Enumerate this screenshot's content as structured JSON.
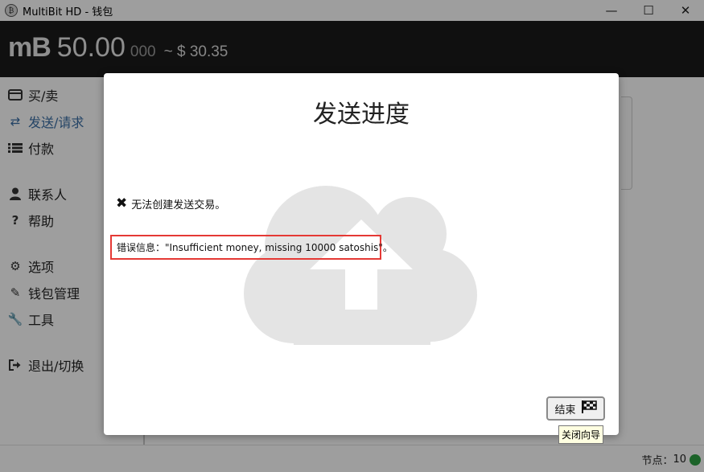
{
  "window": {
    "title": "MultiBit HD - 钱包",
    "minimize": "—",
    "maximize": "☐",
    "close": "✕"
  },
  "header": {
    "currency_symbol": "mB",
    "balance_main": "50.00",
    "balance_decimals": "000",
    "fiat": "~ $ 30.35"
  },
  "sidebar": {
    "items": [
      {
        "label": "买/卖",
        "icon": "credit-card-icon"
      },
      {
        "label": "发送/请求",
        "icon": "exchange-icon"
      },
      {
        "label": "付款",
        "icon": "list-icon"
      },
      {
        "label": "联系人",
        "icon": "user-icon"
      },
      {
        "label": "帮助",
        "icon": "question-icon"
      },
      {
        "label": "选项",
        "icon": "gears-icon"
      },
      {
        "label": "钱包管理",
        "icon": "edit-icon"
      },
      {
        "label": "工具",
        "icon": "wrench-icon"
      },
      {
        "label": "退出/切换",
        "icon": "sign-out-icon"
      }
    ],
    "active_index": 1
  },
  "dialog": {
    "title": "发送进度",
    "status_text": "无法创建发送交易。",
    "error_message": "错误信息：\"Insufficient money, missing 10000 satoshis\"。",
    "finish_label": "结束",
    "finish_tooltip": "关闭向导"
  },
  "footer": {
    "peers_label": "节点：",
    "peers_count": "10",
    "peers_status_color": "#2ea043"
  },
  "colors": {
    "header_bg": "#1b1b1b",
    "active_nav": "#3a6ea5",
    "error_border": "#e53935"
  }
}
